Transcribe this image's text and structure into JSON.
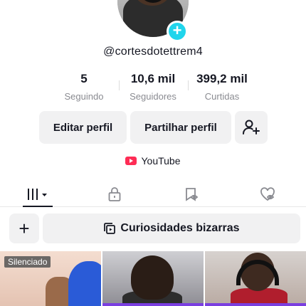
{
  "profile": {
    "username": "@cortesdotettrem4",
    "avatar_icon": "profile-photo",
    "add_icon": "plus-icon"
  },
  "stats": [
    {
      "value": "5",
      "label": "Seguindo"
    },
    {
      "value": "10,6 mil",
      "label": "Seguidores"
    },
    {
      "value": "399,2 mil",
      "label": "Curtidas"
    }
  ],
  "actions": {
    "edit_label": "Editar perfil",
    "share_label": "Partilhar perfil",
    "add_friend_icon": "add-user-icon"
  },
  "link": {
    "label": "YouTube",
    "icon": "youtube-icon"
  },
  "tabs": [
    {
      "name": "videos",
      "icon": "videos-grid-icon",
      "active": true
    },
    {
      "name": "private",
      "icon": "lock-icon",
      "active": false
    },
    {
      "name": "saved",
      "icon": "bookmark-eye-icon",
      "active": false
    },
    {
      "name": "liked",
      "icon": "heart-eye-icon",
      "active": false
    }
  ],
  "playlist": {
    "add_icon": "plus-icon",
    "label": "Curiosidades bizarras",
    "icon": "playlist-icon"
  },
  "videos": [
    {
      "badge": "Silenciado"
    },
    {},
    {}
  ],
  "colors": {
    "accent_cyan": "#20d5ec",
    "brand_red": "#fe2c55",
    "button_bg": "#f1f1f2",
    "text_primary": "#161823",
    "text_secondary": "#8a8b91"
  }
}
